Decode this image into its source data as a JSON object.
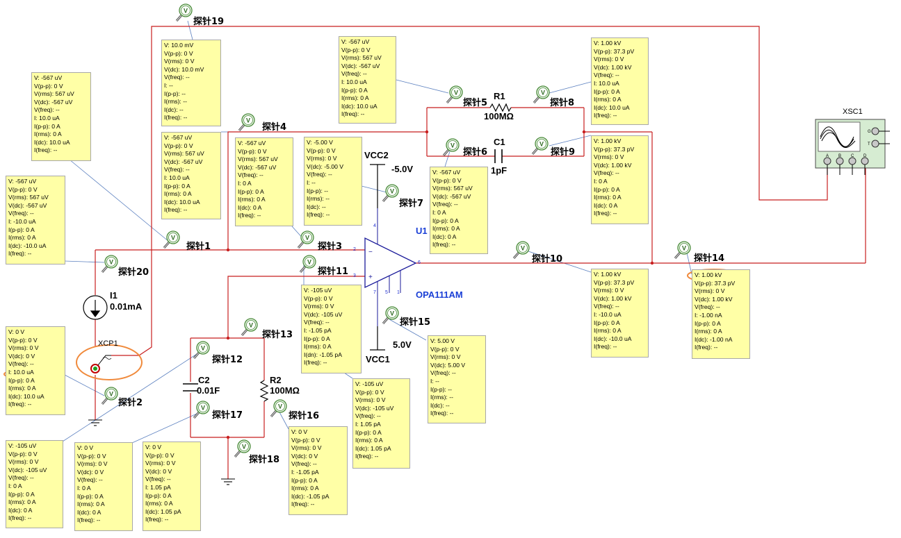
{
  "probes": [
    {
      "id": "p19",
      "label": "探针19",
      "lines": [
        "V: 10.0 mV",
        "V(p-p): 0 V",
        "V(rms): 0 V",
        "V(dc): 10.0 mV",
        "V(freq): --",
        "I: --",
        "I(p-p): --",
        "I(rms): --",
        "I(dc): --",
        "I(freq): --"
      ]
    },
    {
      "id": "p5",
      "label": "探针5",
      "lines": [
        "V: -567 uV",
        "V(p-p): 0 V",
        "V(rms): 567 uV",
        "V(dc): -567 uV",
        "V(freq): --",
        "I: 10.0 uA",
        "I(p-p): 0 A",
        "I(rms): 0 A",
        "I(dc): 10.0 uA",
        "I(freq): --"
      ]
    },
    {
      "id": "p8",
      "label": "探针8",
      "lines": [
        "V: 1.00 kV",
        "V(p-p): 37.3 pV",
        "V(rms): 0 V",
        "V(dc): 1.00 kV",
        "V(freq): --",
        "I: 10.0 uA",
        "I(p-p): 0 A",
        "I(rms): 0 A",
        "I(dc): 10.0 uA",
        "I(freq): --"
      ]
    },
    {
      "id": "pA",
      "label": "",
      "lines": [
        "V: -567 uV",
        "V(p-p): 0 V",
        "V(rms): 567 uV",
        "V(dc): -567 uV",
        "V(freq): --",
        "I: 10.0 uA",
        "I(p-p): 0 A",
        "I(rms): 0 A",
        "I(dc): 10.0 uA",
        "I(freq): --"
      ]
    },
    {
      "id": "p1",
      "label": "探针1",
      "lines": [
        "V: -567 uV",
        "V(p-p): 0 V",
        "V(rms): 567 uV",
        "V(dc): -567 uV",
        "V(freq): --",
        "I: 10.0 uA",
        "I(p-p): 0 A",
        "I(rms): 0 A",
        "I(dc): 10.0 uA",
        "I(freq): --"
      ]
    },
    {
      "id": "p4",
      "label": "探针4",
      "lines": [
        "V: -567 uV",
        "V(p-p): 0 V",
        "V(rms): 567 uV",
        "V(dc): -567 uV",
        "V(freq): --",
        "I: 0 A",
        "I(p-p): 0 A",
        "I(rms): 0 A",
        "I(dc): 0 A",
        "I(freq): --"
      ]
    },
    {
      "id": "p7",
      "label": "探针7",
      "lines": [
        "V: -5.00 V",
        "V(p-p): 0 V",
        "V(rms): 0 V",
        "V(dc): -5.00 V",
        "V(freq): --",
        "I: --",
        "I(p-p): --",
        "I(rms): --",
        "I(dc): --",
        "I(freq): --"
      ]
    },
    {
      "id": "p6",
      "label": "探针6",
      "lines": [
        "V: -567 uV",
        "V(p-p): 0 V",
        "V(rms): 567 uV",
        "V(dc): -567 uV",
        "V(freq): --",
        "I: 0 A",
        "I(p-p): 0 A",
        "I(rms): 0 A",
        "I(dc): 0 A",
        "I(freq): --"
      ]
    },
    {
      "id": "p9",
      "label": "探针9",
      "lines": [
        "V: 1.00 kV",
        "V(p-p): 37.3 pV",
        "V(rms): 0 V",
        "V(dc): 1.00 kV",
        "V(freq): --",
        "I: 0 A",
        "I(p-p): 0 A",
        "I(rms): 0 A",
        "I(dc): 0 A",
        "I(freq): --"
      ]
    },
    {
      "id": "p20",
      "label": "探针20",
      "lines": [
        "V: -567 uV",
        "V(p-p): 0 V",
        "V(rms): 567 uV",
        "V(dc): -567 uV",
        "V(freq): --",
        "I: -10.0 uA",
        "I(p-p): 0 A",
        "I(rms): 0 A",
        "I(dc): -10.0 uA",
        "I(freq): --"
      ]
    },
    {
      "id": "p10",
      "label": "探针10",
      "lines": [
        "V: 1.00 kV",
        "V(p-p): 37.3 pV",
        "V(rms): 0 V",
        "V(dc): 1.00 kV",
        "V(freq): --",
        "I: -10.0 uA",
        "I(p-p): 0 A",
        "I(rms): 0 A",
        "I(dc): -10.0 uA",
        "I(freq): --"
      ]
    },
    {
      "id": "p14",
      "label": "探针14",
      "lines": [
        "V: 1.00 kV",
        "V(p-p): 37.3 pV",
        "V(rms): 0 V",
        "V(dc): 1.00 kV",
        "V(freq): --",
        "I: -1.00 nA",
        "I(p-p): 0 A",
        "I(rms): 0 A",
        "I(dc): -1.00 nA",
        "I(freq): --"
      ]
    },
    {
      "id": "p11",
      "label": "探针11",
      "lines": [
        "V: -105 uV",
        "V(p-p): 0 V",
        "V(rms): 0 V",
        "V(dc): -105 uV",
        "V(freq): --",
        "I: -1.05 pA",
        "I(p-p): 0 A",
        "I(rms): 0 A",
        "I(dn): -1.05 pA",
        "I(freq): --"
      ]
    },
    {
      "id": "p15",
      "label": "探针15",
      "lines": [
        "V: 5.00 V",
        "V(p-p): 0 V",
        "V(rms): 0 V",
        "V(dc): 5.00 V",
        "V(freq): --",
        "I: --",
        "I(p-p): --",
        "I(rms): --",
        "I(dc): --",
        "I(freq): --"
      ]
    },
    {
      "id": "p2",
      "label": "探针2",
      "lines": [
        "V: 0 V",
        "V(p-p): 0 V",
        "V(rms): 0 V",
        "V(dc): 0 V",
        "V(freq): --",
        "I: 10.0 uA",
        "I(p-p): 0 A",
        "I(rms): 0 A",
        "I(dc): 10.0 uA",
        "I(freq): --"
      ]
    },
    {
      "id": "p13",
      "label": "探针13",
      "lines": [
        "V: -105 uV",
        "V(p-p): 0 V",
        "V(rms): 0 V",
        "V(dc): -105 uV",
        "V(freq): --",
        "I: 1.05 pA",
        "I(p-p): 0 A",
        "I(rms): 0 A",
        "I(dc): 1.05 pA",
        "I(freq): --"
      ]
    },
    {
      "id": "p16",
      "label": "探针16",
      "lines": [
        "V: 0 V",
        "V(p-p): 0 V",
        "V(rms): 0 V",
        "V(dc): 0 V",
        "V(freq): --",
        "I: -1.05 pA",
        "I(p-p): 0 A",
        "I(rms): 0 A",
        "I(dc): -1.05 pA",
        "I(freq): --"
      ]
    },
    {
      "id": "pB",
      "label": "",
      "lines": [
        "V: -105 uV",
        "V(p-p): 0 V",
        "V(rms): 0 V",
        "V(dc): -105 uV",
        "V(freq): --",
        "I: 0 A",
        "I(p-p): 0 A",
        "I(rms): 0 A",
        "I(dc): 0 A",
        "I(freq): --"
      ]
    },
    {
      "id": "p12",
      "label": "探针12",
      "lines": [
        "V: 0 V",
        "V(p-p): 0 V",
        "V(rms): 0 V",
        "V(dc): 0 V",
        "V(freq): --",
        "I: 0 A",
        "I(p-p): 0 A",
        "I(rms): 0 A",
        "I(dc): 0 A",
        "I(freq): --"
      ]
    },
    {
      "id": "p17",
      "label": "探针17",
      "lines": [
        "V: 0 V",
        "V(p-p): 0 V",
        "V(rms): 0 V",
        "V(dc): 0 V",
        "V(freq): --",
        "I: 1.05 pA",
        "I(p-p): 0 A",
        "I(rms): 0 A",
        "I(dc): 1.05 pA",
        "I(freq): --"
      ]
    },
    {
      "id": "p3",
      "label": "探针3",
      "lines": []
    },
    {
      "id": "p18",
      "label": "探针18",
      "lines": []
    }
  ],
  "components": {
    "r1": {
      "name": "R1",
      "value": "100MΩ"
    },
    "c1": {
      "name": "C1",
      "value": "1pF"
    },
    "r2": {
      "name": "R2",
      "value": "100MΩ"
    },
    "c2": {
      "name": "C2",
      "value": "0.01F"
    },
    "i1": {
      "name": "I1",
      "value": "0.01mA"
    },
    "xcp1": {
      "name": "XCP1"
    },
    "u1": {
      "name": "U1",
      "model": "OPA111AM"
    },
    "vcc2": {
      "name": "VCC2",
      "value": "-5.0V"
    },
    "vcc1": {
      "name": "VCC1",
      "value": "5.0V"
    },
    "xsc1": {
      "name": "XSC1",
      "terminals": [
        "A",
        "B",
        "C",
        "D"
      ],
      "side_terminals": [
        "G",
        "T"
      ]
    }
  },
  "colors": {
    "wire": "#c81e1e",
    "probe_box": "#ffffa6",
    "highlight": "#f08a3c",
    "net_label": "#1a3fd6",
    "probe_line": "#5a7fbf"
  }
}
